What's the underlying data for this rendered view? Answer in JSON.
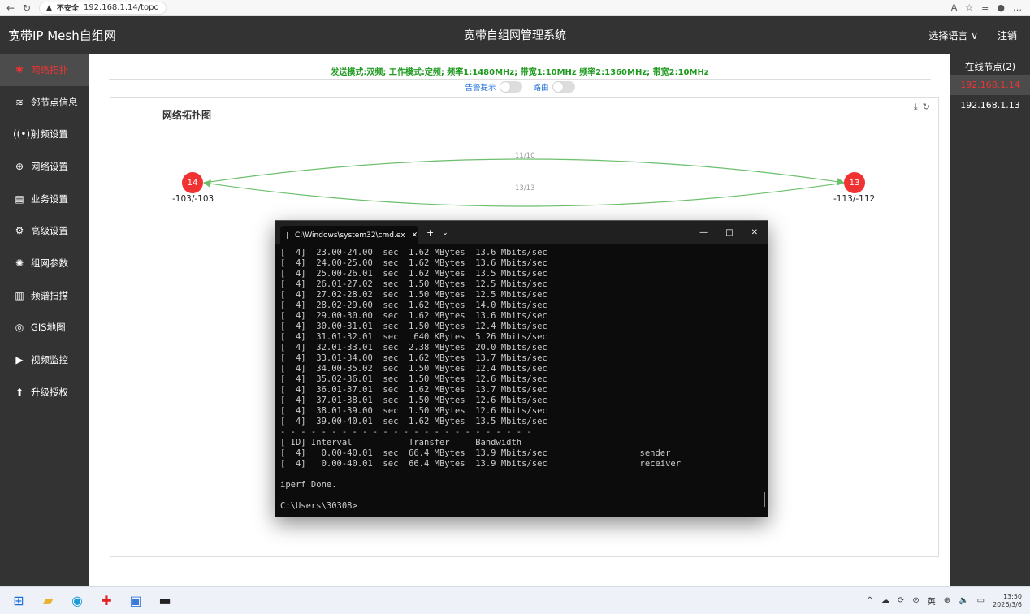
{
  "browser": {
    "security_label": "不安全",
    "url": "192.168.1.14/topo"
  },
  "header": {
    "brand": "宽带IP Mesh自组网",
    "title": "宽带自组网管理系统",
    "language": "选择语言",
    "logout": "注销"
  },
  "sidebar": {
    "items": [
      {
        "label": "网络拓扑",
        "icon": "topology-icon"
      },
      {
        "label": "邻节点信息",
        "icon": "neighbor-icon"
      },
      {
        "label": "射频设置",
        "icon": "radio-icon"
      },
      {
        "label": "网络设置",
        "icon": "globe-icon"
      },
      {
        "label": "业务设置",
        "icon": "service-icon"
      },
      {
        "label": "高级设置",
        "icon": "gear-icon"
      },
      {
        "label": "组网参数",
        "icon": "network-param-icon"
      },
      {
        "label": "频谱扫描",
        "icon": "spectrum-icon"
      },
      {
        "label": "GIS地图",
        "icon": "map-pin-icon"
      },
      {
        "label": "视频监控",
        "icon": "camera-icon"
      },
      {
        "label": "升级授权",
        "icon": "upgrade-icon"
      }
    ]
  },
  "main": {
    "mode_line": "发送模式:双频;  工作模式:定频;  频率1:1480MHz;  带宽1:10MHz   频率2:1360MHz;  带宽2:10MHz",
    "alarm_label": "告警提示",
    "route_label": "路由",
    "topo_title": "网络拓扑图",
    "nodes": [
      {
        "id": "14",
        "rssi": "-103/-103"
      },
      {
        "id": "13",
        "rssi": "-113/-112"
      }
    ],
    "links": [
      {
        "label": "11/10"
      },
      {
        "label": "13/13"
      }
    ]
  },
  "right_panel": {
    "title": "在线节点(2)",
    "nodes": [
      "192.168.1.14",
      "192.168.1.13"
    ]
  },
  "cmd": {
    "title": "C:\\Windows\\system32\\cmd.ex",
    "lines": [
      "[  4]  23.00-24.00  sec  1.62 MBytes  13.6 Mbits/sec",
      "[  4]  24.00-25.00  sec  1.62 MBytes  13.6 Mbits/sec",
      "[  4]  25.00-26.01  sec  1.62 MBytes  13.5 Mbits/sec",
      "[  4]  26.01-27.02  sec  1.50 MBytes  12.5 Mbits/sec",
      "[  4]  27.02-28.02  sec  1.50 MBytes  12.5 Mbits/sec",
      "[  4]  28.02-29.00  sec  1.62 MBytes  14.0 Mbits/sec",
      "[  4]  29.00-30.00  sec  1.62 MBytes  13.6 Mbits/sec",
      "[  4]  30.00-31.01  sec  1.50 MBytes  12.4 Mbits/sec",
      "[  4]  31.01-32.01  sec   640 KBytes  5.26 Mbits/sec",
      "[  4]  32.01-33.01  sec  2.38 MBytes  20.0 Mbits/sec",
      "[  4]  33.01-34.00  sec  1.62 MBytes  13.7 Mbits/sec",
      "[  4]  34.00-35.02  sec  1.50 MBytes  12.4 Mbits/sec",
      "[  4]  35.02-36.01  sec  1.50 MBytes  12.6 Mbits/sec",
      "[  4]  36.01-37.01  sec  1.62 MBytes  13.7 Mbits/sec",
      "[  4]  37.01-38.01  sec  1.50 MBytes  12.6 Mbits/sec",
      "[  4]  38.01-39.00  sec  1.50 MBytes  12.6 Mbits/sec",
      "[  4]  39.00-40.01  sec  1.62 MBytes  13.5 Mbits/sec",
      "- - - - - - - - - - - - - - - - - - - - - - - - -",
      "[ ID] Interval           Transfer     Bandwidth",
      "[  4]   0.00-40.01  sec  66.4 MBytes  13.9 Mbits/sec                  sender",
      "[  4]   0.00-40.01  sec  66.4 MBytes  13.9 Mbits/sec                  receiver",
      "",
      "iperf Done.",
      "",
      "C:\\Users\\30308>"
    ]
  },
  "taskbar": {
    "ime": "英",
    "time": "13:50",
    "date": "2026/3/6"
  }
}
